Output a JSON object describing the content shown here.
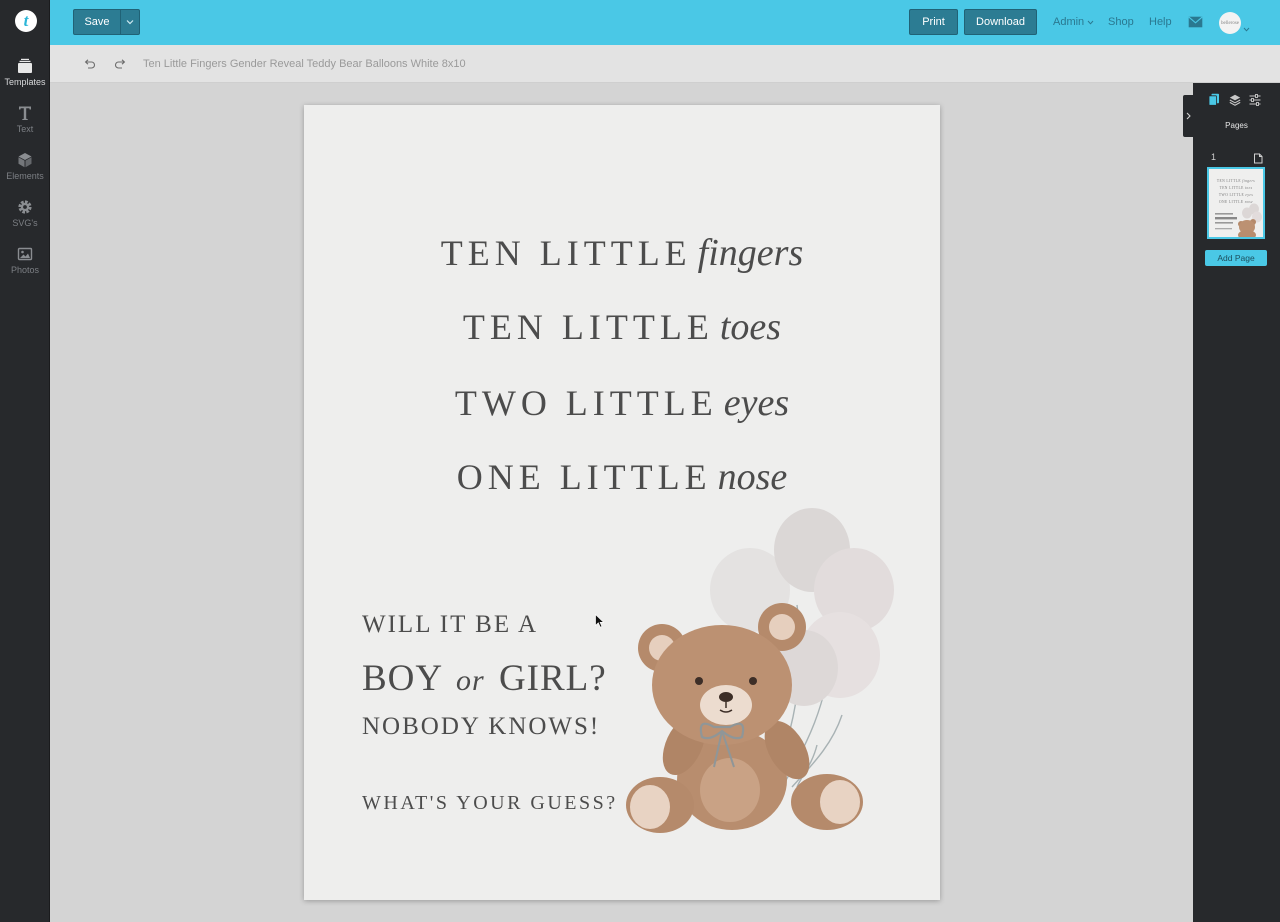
{
  "sidebar": {
    "logo_letter": "t",
    "items": [
      {
        "label": "Templates",
        "active": true
      },
      {
        "label": "Text"
      },
      {
        "label": "Elements"
      },
      {
        "label": "SVG's"
      },
      {
        "label": "Photos"
      }
    ]
  },
  "topbar": {
    "save_label": "Save",
    "print_label": "Print",
    "download_label": "Download",
    "admin_label": "Admin",
    "shop_label": "Shop",
    "help_label": "Help",
    "avatar_text": "bellerose"
  },
  "toolbar": {
    "document_title": "Ten Little Fingers Gender Reveal Teddy Bear Balloons White 8x10"
  },
  "design": {
    "lines": [
      {
        "caps": "TEN LITTLE",
        "script": "fingers"
      },
      {
        "caps": "TEN LITTLE",
        "script": "toes"
      },
      {
        "caps": "TWO LITTLE",
        "script": "eyes"
      },
      {
        "caps": "ONE LITTLE",
        "script": "nose"
      }
    ],
    "will_it_be": "WILL IT BE A",
    "boy": "BOY",
    "or": "or",
    "girl": "GIRL?",
    "nobody_knows": "NOBODY KNOWS!",
    "guess": "WHAT'S YOUR GUESS?"
  },
  "right_panel": {
    "pages_label": "Pages",
    "page_number": "1",
    "add_page_label": "Add Page"
  },
  "colors": {
    "accent": "#4ac8e6",
    "button": "#2c7c93",
    "sidebar": "#27292c"
  }
}
